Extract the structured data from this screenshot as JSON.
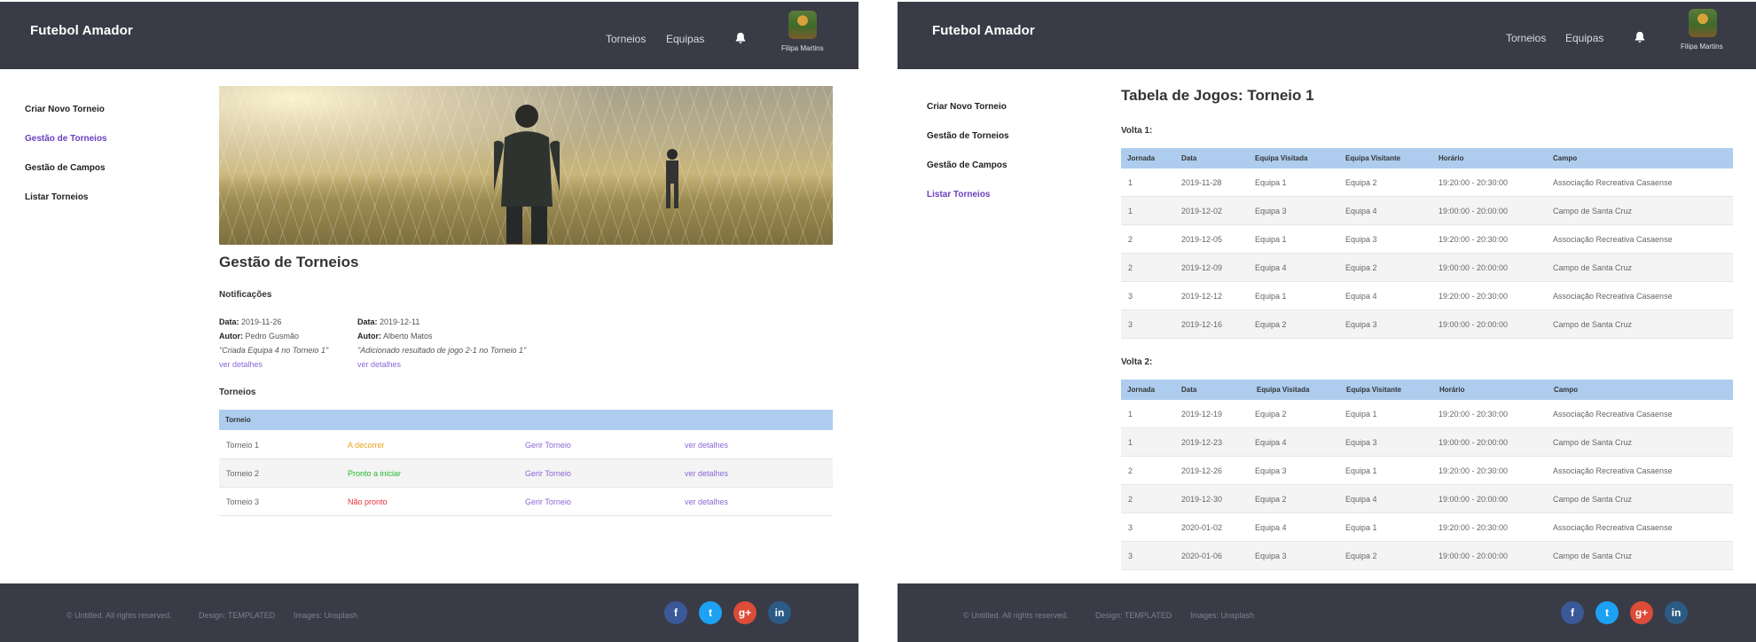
{
  "app": {
    "brand": "Futebol Amador",
    "nav": [
      "Torneios",
      "Equipas"
    ],
    "user_name": "Filipa Martins"
  },
  "sidebar": {
    "items": [
      "Criar Novo Torneio",
      "Gestão de Torneios",
      "Gestão de Campos",
      "Listar Torneios"
    ]
  },
  "left": {
    "title": "Gestão de Torneios",
    "notifications_heading": "Notificações",
    "notifications": [
      {
        "date_label": "Data",
        "date": "2019-11-26",
        "author_label": "Autor",
        "author": "Pedro Gusmão",
        "message": "\"Criada Equipa 4 no Torneio 1\"",
        "link": "ver detalhes"
      },
      {
        "date_label": "Data",
        "date": "2019-12-11",
        "author_label": "Autor",
        "author": "Alberto Matos",
        "message": "\"Adicionado resultado de jogo 2-1 no Torneio 1\"",
        "link": "ver detalhes"
      }
    ],
    "tournaments_heading": "Torneios",
    "table_header": "Torneio",
    "tournaments": [
      {
        "name": "Torneio 1",
        "status": "A decorrer",
        "status_color": "#e8a21c",
        "manage": "Gerir Torneio",
        "details": "ver detalhes"
      },
      {
        "name": "Torneio 2",
        "status": "Pronto a iniciar",
        "status_color": "#25b82a",
        "manage": "Gerir Torneio",
        "details": "ver detalhes"
      },
      {
        "name": "Torneio 3",
        "status": "Não pronto",
        "status_color": "#e3343a",
        "manage": "Gerir Torneio",
        "details": "ver detalhes"
      }
    ]
  },
  "right": {
    "title": "Tabela de Jogos: Torneio 1",
    "columns": [
      "Jornada",
      "Data",
      "Equipa Visitada",
      "Equipa Visitante",
      "Horário",
      "Campo"
    ],
    "rounds": [
      {
        "label": "Volta 1:",
        "games": [
          [
            "1",
            "2019-11-28",
            "Equipa 1",
            "Equipa 2",
            "19:20:00 - 20:30:00",
            "Associação Recreativa Casaense"
          ],
          [
            "1",
            "2019-12-02",
            "Equipa 3",
            "Equipa 4",
            "19:00:00 - 20:00:00",
            "Campo de Santa Cruz"
          ],
          [
            "2",
            "2019-12-05",
            "Equipa 1",
            "Equipa 3",
            "19:20:00 - 20:30:00",
            "Associação Recreativa Casaense"
          ],
          [
            "2",
            "2019-12-09",
            "Equipa 4",
            "Equipa 2",
            "19:00:00 - 20:00:00",
            "Campo de Santa Cruz"
          ],
          [
            "3",
            "2019-12-12",
            "Equipa 1",
            "Equipa 4",
            "19:20:00 - 20:30:00",
            "Associação Recreativa Casaense"
          ],
          [
            "3",
            "2019-12-16",
            "Equipa 2",
            "Equipa 3",
            "19:00:00 - 20:00:00",
            "Campo de Santa Cruz"
          ]
        ]
      },
      {
        "label": "Volta 2:",
        "games": [
          [
            "1",
            "2019-12-19",
            "Equipa 2",
            "Equipa 1",
            "19:20:00 - 20:30:00",
            "Associação Recreativa Casaense"
          ],
          [
            "1",
            "2019-12-23",
            "Equipa 4",
            "Equipa 3",
            "19:00:00 - 20:00:00",
            "Campo de Santa Cruz"
          ],
          [
            "2",
            "2019-12-26",
            "Equipa 3",
            "Equipa 1",
            "19:20:00 - 20:30:00",
            "Associação Recreativa Casaense"
          ],
          [
            "2",
            "2019-12-30",
            "Equipa 2",
            "Equipa 4",
            "19:00:00 - 20:00:00",
            "Campo de Santa Cruz"
          ],
          [
            "3",
            "2020-01-02",
            "Equipa 4",
            "Equipa 1",
            "19:20:00 - 20:30:00",
            "Associação Recreativa Casaense"
          ],
          [
            "3",
            "2020-01-06",
            "Equipa 3",
            "Equipa 2",
            "19:00:00 - 20:00:00",
            "Campo de Santa Cruz"
          ]
        ]
      }
    ]
  },
  "footer": {
    "copyright": "© Untitled. All rights reserved.",
    "design": "Design: TEMPLATED",
    "images": "Images: Unsplash",
    "social": [
      {
        "icon": "facebook-icon",
        "glyph": "f",
        "color": "#3b5998"
      },
      {
        "icon": "twitter-icon",
        "glyph": "t",
        "color": "#1da1f2"
      },
      {
        "icon": "google-plus-icon",
        "glyph": "g+",
        "color": "#dd4b39"
      },
      {
        "icon": "linkedin-icon",
        "glyph": "in",
        "color": "#2b5b84"
      }
    ]
  }
}
